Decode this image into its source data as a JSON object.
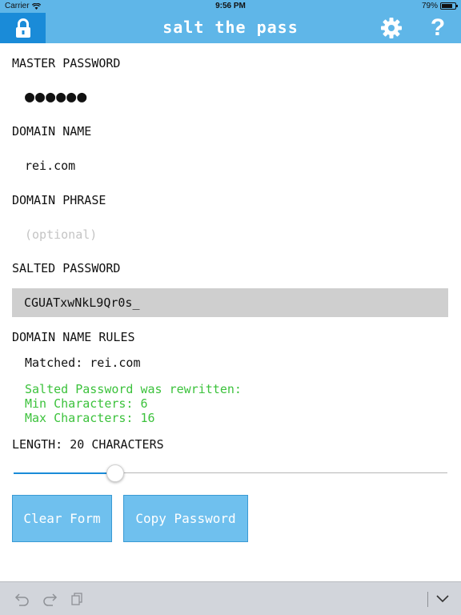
{
  "status": {
    "carrier": "Carrier",
    "time": "9:56 PM",
    "battery_text": "79%",
    "battery_level": 0.79
  },
  "nav": {
    "title": "salt the pass",
    "help_label": "?"
  },
  "form": {
    "master_password_label": "MASTER PASSWORD",
    "master_password_value": "●●●●●●",
    "domain_name_label": "DOMAIN NAME",
    "domain_name_value": "rei.com",
    "domain_phrase_label": "DOMAIN PHRASE",
    "domain_phrase_placeholder": "(optional)",
    "salted_password_label": "SALTED PASSWORD",
    "salted_password_value": "CGUATxwNkL9Qr0s_",
    "domain_rules_label": "DOMAIN NAME RULES",
    "matched_text": "Matched: rei.com",
    "rewritten_lines": [
      "Salted Password was rewritten:",
      "Min Characters: 6",
      "Max Characters: 16"
    ],
    "length_label": "LENGTH: 20 CHARACTERS",
    "length_slider_fraction": 0.235
  },
  "buttons": {
    "clear_label": "Clear Form",
    "copy_label": "Copy Password"
  },
  "colors": {
    "nav_bar": "#5fb6e8",
    "accent": "#1a8bd8",
    "button": "#6fc0ee",
    "rule_text": "#3cc23c",
    "salted_box": "#cfcfcf"
  },
  "icons": {
    "lock": "lock-icon",
    "settings": "gear-icon",
    "undo": "undo-icon",
    "redo": "redo-icon",
    "paste": "paste-icon",
    "dismiss": "chevron-down-icon"
  }
}
